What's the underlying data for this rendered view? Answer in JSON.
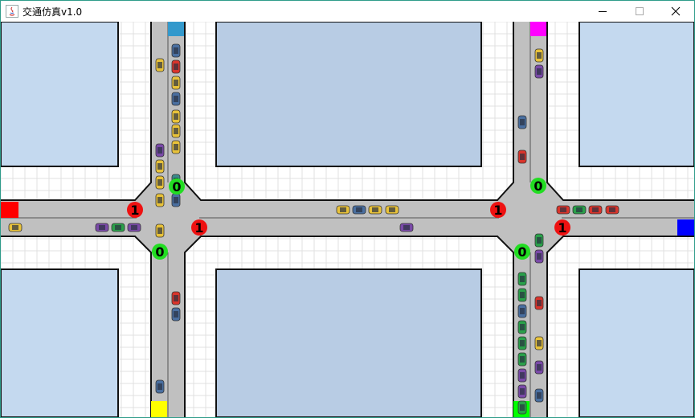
{
  "window": {
    "title": "交通仿真v1.0",
    "accent_border": "#2f9c8a"
  },
  "titlebar_controls": [
    {
      "name": "minimize-button",
      "icon": "minimize-icon"
    },
    {
      "name": "maximize-button",
      "icon": "maximize-icon"
    },
    {
      "name": "close-button",
      "icon": "close-icon"
    }
  ],
  "colors": {
    "road": "#c0c0c0",
    "block": "#c4d9ef",
    "block_center": "#b8cce4",
    "grid_bg": "#ffffff",
    "grid_line": "#e1e1e1",
    "curb": "#111111",
    "signal_red": "#ee1111",
    "signal_green": "#22dd22",
    "car_colors": {
      "yellow": "#e8c23a",
      "red": "#d9342b",
      "blue": "#4a6fa0",
      "purple": "#7a4aa8",
      "green": "#2aa04a",
      "teal": "#3a8a8a"
    }
  },
  "simulation": {
    "signals": [
      {
        "id": "w-intersection-west",
        "label": "1",
        "state": "red"
      },
      {
        "id": "w-intersection-east",
        "label": "1",
        "state": "red"
      },
      {
        "id": "w-intersection-south",
        "label": "0",
        "state": "green"
      },
      {
        "id": "w-intersection-north",
        "label": "0",
        "state": "green"
      },
      {
        "id": "e-intersection-west",
        "label": "1",
        "state": "red"
      },
      {
        "id": "e-intersection-east",
        "label": "1",
        "state": "red"
      },
      {
        "id": "e-intersection-north",
        "label": "0",
        "state": "green"
      },
      {
        "id": "e-intersection-south",
        "label": "0",
        "state": "green"
      }
    ],
    "spawn_points": [
      {
        "id": "spawn-north-west",
        "color": "#3399cc"
      },
      {
        "id": "spawn-north-east",
        "color": "#ff00ff"
      },
      {
        "id": "spawn-west",
        "color": "#ff0000"
      },
      {
        "id": "spawn-east",
        "color": "#0000ff"
      },
      {
        "id": "spawn-south-west",
        "color": "#ffff00"
      },
      {
        "id": "spawn-south-east",
        "color": "#00ff00"
      }
    ]
  }
}
